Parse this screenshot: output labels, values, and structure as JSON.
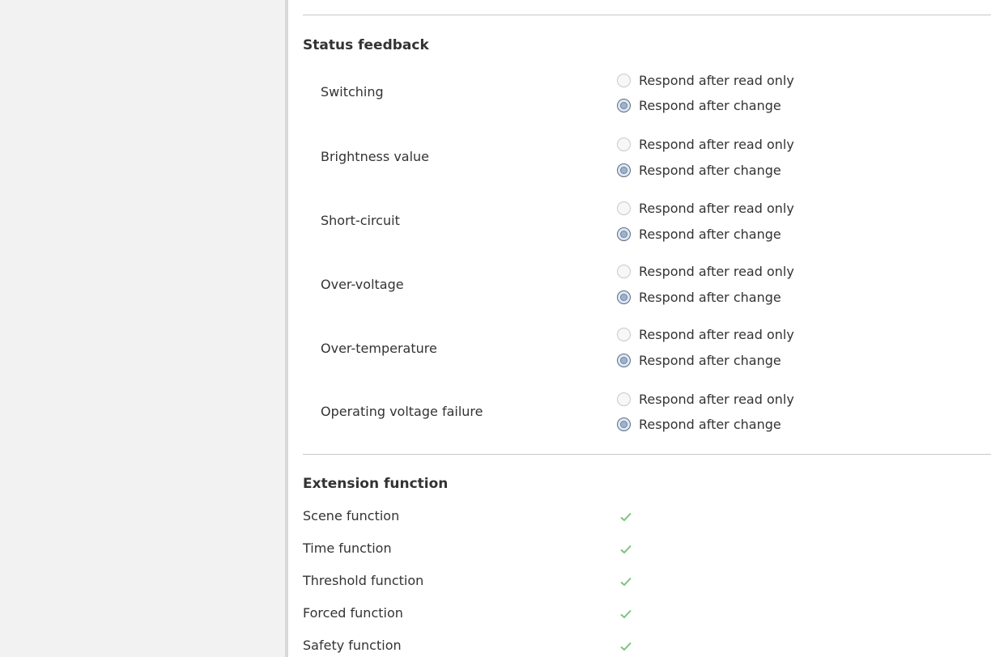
{
  "status_feedback": {
    "title": "Status feedback",
    "options": {
      "read_only": "Respond after read only",
      "after_change": "Respond after change"
    },
    "params": [
      {
        "label": "Switching",
        "selected": "after_change"
      },
      {
        "label": "Brightness value",
        "selected": "after_change"
      },
      {
        "label": "Short-circuit",
        "selected": "after_change"
      },
      {
        "label": "Over-voltage",
        "selected": "after_change"
      },
      {
        "label": "Over-temperature",
        "selected": "after_change"
      },
      {
        "label": "Operating voltage failure",
        "selected": "after_change"
      }
    ]
  },
  "extension_function": {
    "title": "Extension function",
    "items": [
      {
        "label": "Scene function",
        "checked": true
      },
      {
        "label": "Time function",
        "checked": true
      },
      {
        "label": "Threshold function",
        "checked": true
      },
      {
        "label": "Forced function",
        "checked": true
      },
      {
        "label": "Safety function",
        "checked": true
      }
    ]
  },
  "colors": {
    "check": "#7cc47a",
    "left_panel": "#f2f2f2",
    "divider": "#c8c8c8"
  }
}
